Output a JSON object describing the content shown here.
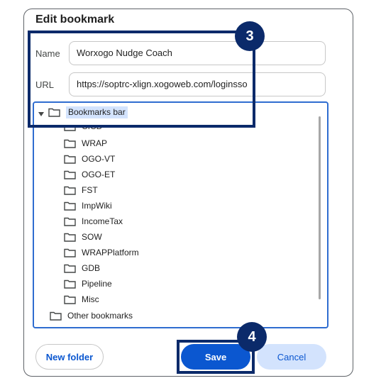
{
  "dialog": {
    "title": "Edit bookmark"
  },
  "name_field": {
    "label": "Name",
    "value": "Worxogo Nudge Coach"
  },
  "url_field": {
    "label": "URL",
    "value": "https://soptrc-xlign.xogoweb.com/loginsso"
  },
  "tree": {
    "root": "Bookmarks bar",
    "children": [
      "CICD",
      "WRAP",
      "OGO-VT",
      "OGO-ET",
      "FST",
      "ImpWiki",
      "IncomeTax",
      "SOW",
      "WRAPPlatform",
      "GDB",
      "Pipeline",
      "Misc"
    ],
    "other": "Other bookmarks"
  },
  "buttons": {
    "new_folder": "New folder",
    "save": "Save",
    "cancel": "Cancel"
  },
  "callouts": {
    "step3": "3",
    "step4": "4"
  },
  "colors": {
    "accent": "#0b57d0",
    "selection": "#d3e3fd",
    "callout": "#0b2a6a",
    "focus_border": "#2f6dd0"
  }
}
